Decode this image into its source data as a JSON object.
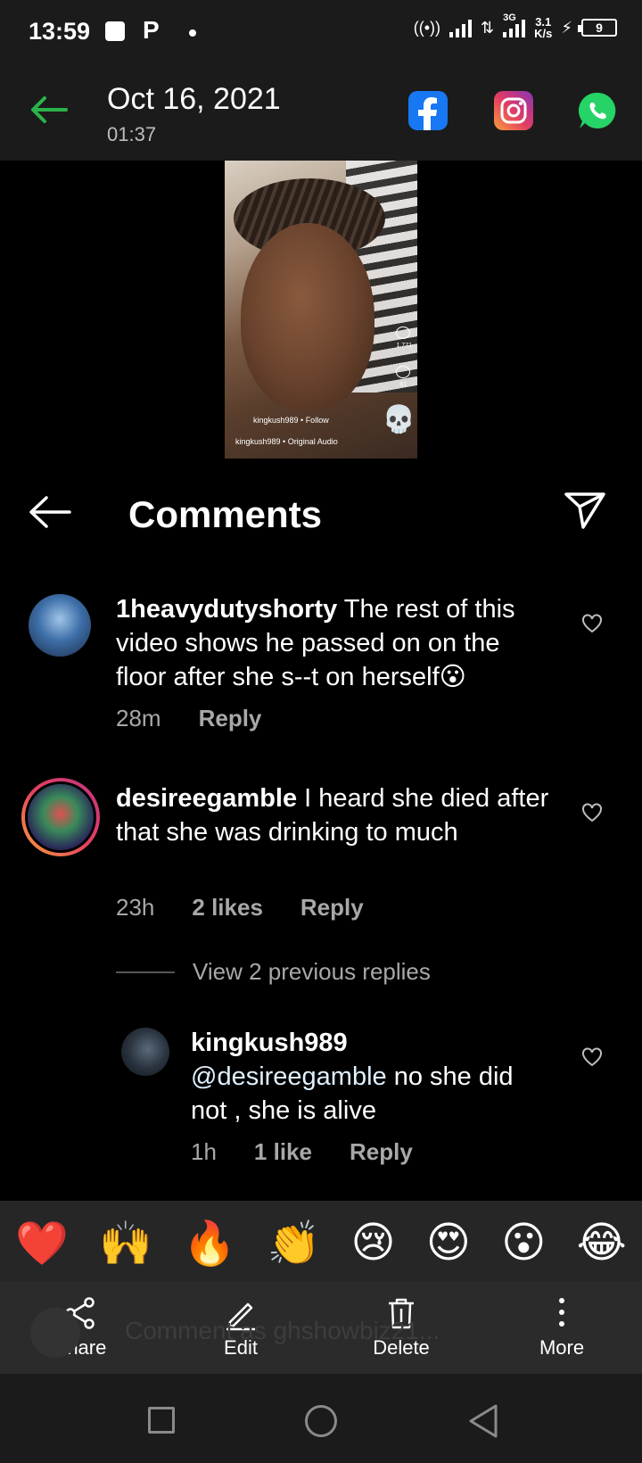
{
  "status_bar": {
    "time": "13:59",
    "carrier_icon": "P",
    "network": "3G",
    "speed_value": "3.1",
    "speed_unit": "K/s",
    "battery": "9"
  },
  "header": {
    "date": "Oct 16, 2021",
    "time": "01:37",
    "share_icons": [
      "facebook-icon",
      "instagram-icon",
      "whatsapp-icon"
    ]
  },
  "photo_overlay": {
    "like_count": "1,771",
    "comment_count": "61",
    "author": "kingkush989 • Follow",
    "audio": "kingkush989 • Original Audio"
  },
  "comments_screen": {
    "title": "Comments",
    "comments": [
      {
        "username": "1heavydutyshorty",
        "text": " The rest of this video shows he passed on on the floor after she s--t on herself😮",
        "age": "28m",
        "likes": "",
        "reply": "Reply"
      },
      {
        "username": "desireegamble",
        "text": " I heard she died after that she was drinking to much",
        "age": "23h",
        "likes": "2 likes",
        "reply": "Reply"
      }
    ],
    "view_replies": "View 2 previous replies",
    "reply": {
      "username": "kingkush989",
      "mention": "@desireegamble",
      "text": " no she did not , she is alive",
      "age": "1h",
      "likes": "1 like",
      "reply": "Reply"
    },
    "emojis": [
      "❤️",
      "🙌",
      "🔥",
      "👏",
      "😢",
      "😍",
      "😮",
      "😂"
    ],
    "comment_placeholder": "Comment as ghshowbiz21..."
  },
  "action_bar": {
    "share": "Share",
    "edit": "Edit",
    "delete": "Delete",
    "more": "More"
  },
  "colors": {
    "accent_green": "#2bb34a",
    "mention_blue": "#e0f1ff",
    "meta_gray": "#a8a8a8"
  }
}
